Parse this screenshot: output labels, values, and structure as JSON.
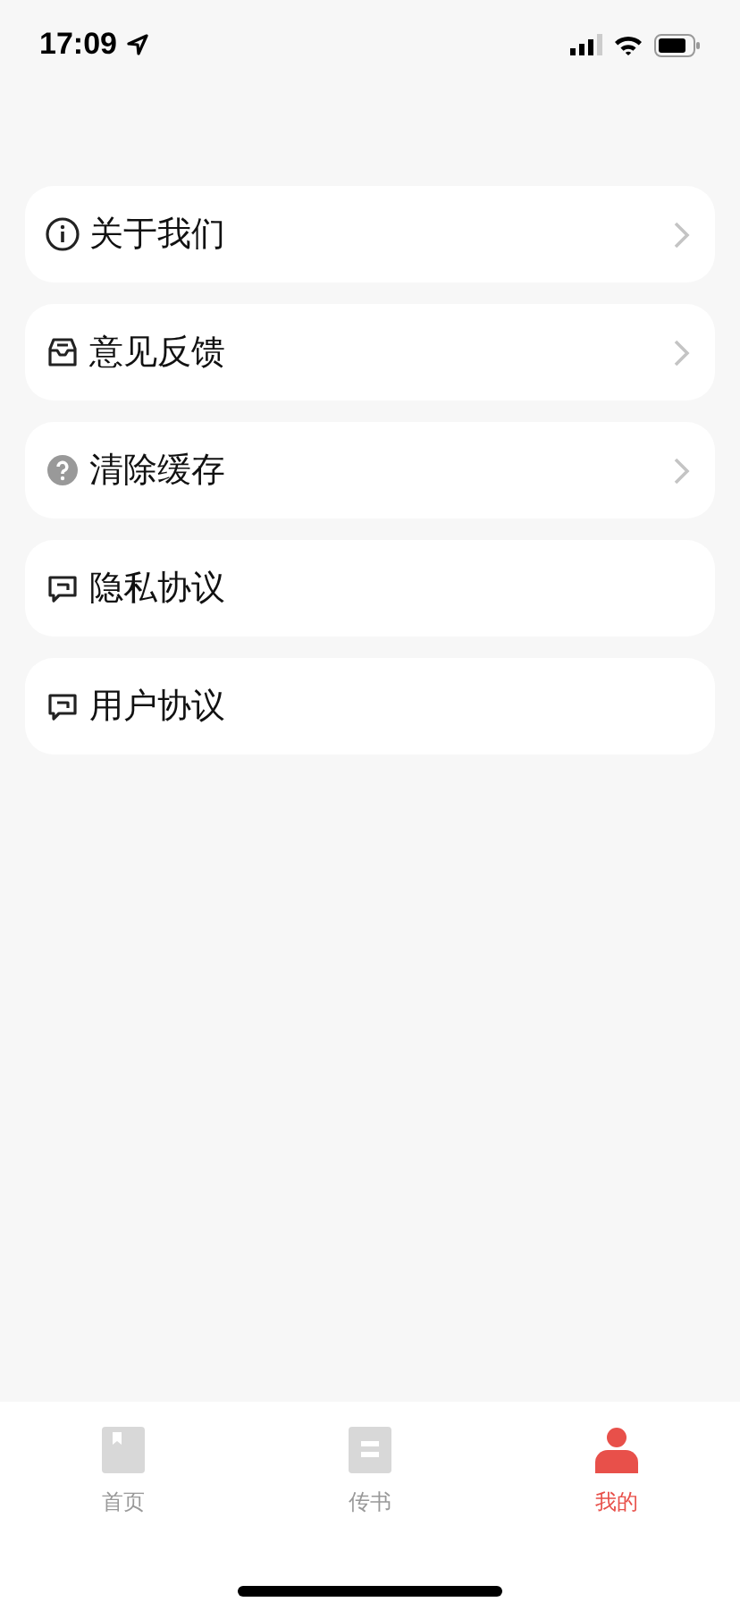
{
  "status_bar": {
    "time": "17:09"
  },
  "menu": [
    {
      "label": "关于我们",
      "kind": "info",
      "chevron": true
    },
    {
      "label": "意见反馈",
      "kind": "feedback",
      "chevron": true
    },
    {
      "label": "清除缓存",
      "kind": "help",
      "chevron": true
    },
    {
      "label": "隐私协议",
      "kind": "message",
      "chevron": false
    },
    {
      "label": "用户协议",
      "kind": "message",
      "chevron": false
    }
  ],
  "tabs": [
    {
      "label": "首页",
      "kind": "book",
      "selected": false
    },
    {
      "label": "传书",
      "kind": "list",
      "selected": false
    },
    {
      "label": "我的",
      "kind": "person",
      "selected": true
    }
  ]
}
